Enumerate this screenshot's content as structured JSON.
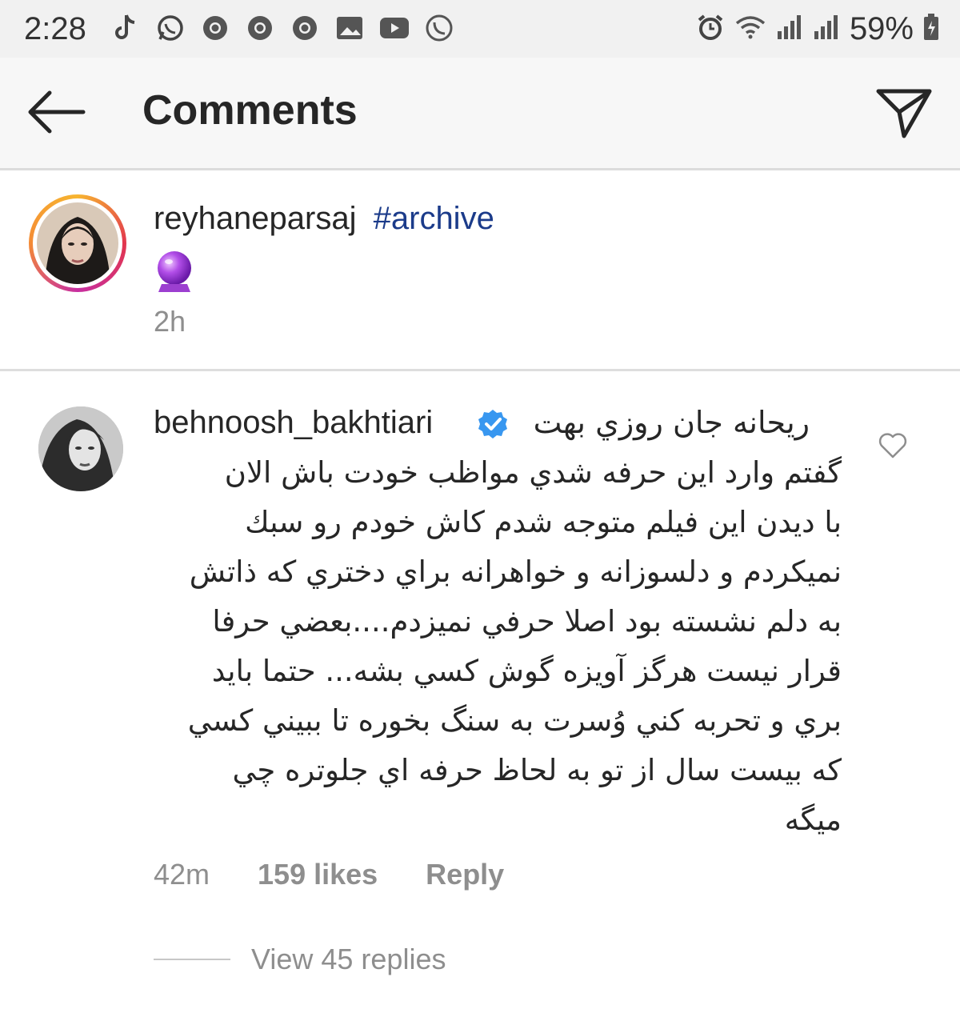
{
  "status_bar": {
    "time": "2:28",
    "battery": "59%",
    "left_icons": [
      "tiktok-icon",
      "whatsapp-icon",
      "chrome-icon",
      "chrome-icon",
      "chrome-icon",
      "gallery-icon",
      "youtube-icon",
      "call-icon"
    ],
    "right_icons": [
      "alarm-icon",
      "wifi-icon",
      "signal-icon",
      "signal-icon",
      "battery-icon"
    ]
  },
  "header": {
    "title": "Comments",
    "back_icon": "arrow-left-icon",
    "send_icon": "send-icon"
  },
  "caption": {
    "username": "reyhaneparsaj",
    "hashtag": "#archive",
    "emoji": "crystal-ball-emoji",
    "time": "2h",
    "story_ring_colors": [
      "#f7b530",
      "#e2364e",
      "#c72ea0"
    ]
  },
  "comment": {
    "username": "behnoosh_bakhtiari",
    "verified": true,
    "first_line": "ريحانه جان روزي بهت",
    "lines": [
      "گفتم وارد اين حرفه شدي مواظب خودت باش الان",
      "با ديدن اين فيلم متوجه شدم كاش خودم رو سبك",
      "نميكردم و دلسوزانه و خواهرانه براي دختري كه ذاتش",
      "به دلم نشسته بود اصلا حرفي نميزدم....بعضي حرفا",
      "قرار نيست هرگز آويزه گوش كسي بشه... حتما بايد",
      "بري و تحربه كني وُسرت به سنگ بخوره تا ببيني كسي",
      "كه بيست سال از تو به لحاظ حرفه اي جلوتره چي",
      "ميگه"
    ],
    "time": "42m",
    "likes": "159 likes",
    "reply_label": "Reply",
    "view_replies": "View 45 replies",
    "verified_color": "#3897f0"
  }
}
